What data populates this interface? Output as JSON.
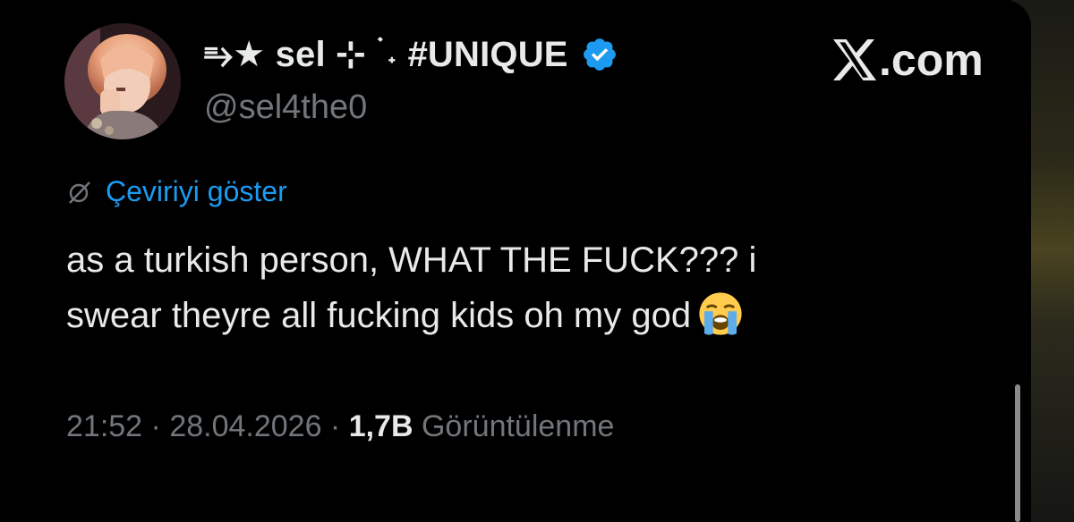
{
  "author": {
    "display_name": "⥱★ sel ⊹ ࣪ ˖ #UNIQUE",
    "handle": "@sel4the0",
    "verified": true
  },
  "brand": {
    "site": ".com"
  },
  "translate": {
    "label": "Çeviriyi göster"
  },
  "tweet": {
    "line1": "as a turkish person, WHAT THE FUCK??? i",
    "line2": "swear theyre all fucking kids oh my god",
    "emoji": "loudly-crying-face"
  },
  "meta": {
    "time": "21:52",
    "sep1": " · ",
    "date": "28.04.2026",
    "sep2": " · ",
    "views_count": "1,7B",
    "views_label": " Görüntülenme"
  },
  "colors": {
    "background": "#000000",
    "text": "#e7e9ea",
    "muted": "#71767b",
    "accent": "#1d9bf0"
  }
}
